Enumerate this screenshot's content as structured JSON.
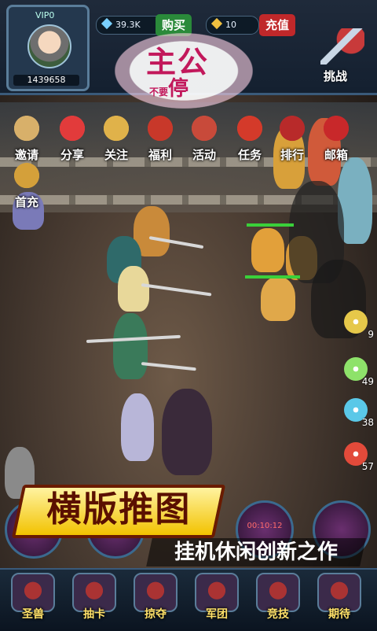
{
  "player": {
    "level_label": "VIP0",
    "power": "1439658"
  },
  "resources": {
    "gems": "39.3K",
    "stamina": "10"
  },
  "top_buttons": {
    "buy_label": "购买",
    "recharge_label": "充值",
    "challenge_label": "挑战"
  },
  "logo": {
    "line1": "主公",
    "line2_small": "不要",
    "line2_big": "停"
  },
  "menu": [
    {
      "label": "邀请",
      "icon": "horn-icon",
      "color": "#d8b06a"
    },
    {
      "label": "分享",
      "icon": "heart-icon",
      "color": "#e23b3b"
    },
    {
      "label": "关注",
      "icon": "scroll-icon",
      "color": "#e0b24a"
    },
    {
      "label": "福利",
      "icon": "giftbox-icon",
      "color": "#c8382a"
    },
    {
      "label": "活动",
      "icon": "drum-icon",
      "color": "#c84a3a"
    },
    {
      "label": "任务",
      "icon": "flag-icon",
      "color": "#d43a2a"
    },
    {
      "label": "排行",
      "icon": "ranking-icon",
      "color": "#b82a2a"
    },
    {
      "label": "邮箱",
      "icon": "mailbox-icon",
      "color": "#c8282a"
    },
    {
      "label": "首充",
      "icon": "treasure-chest-icon",
      "color": "#d4a03a"
    }
  ],
  "drops": [
    {
      "count": "9",
      "color": "#e6c84a"
    },
    {
      "count": "49",
      "color": "#8ee26a"
    },
    {
      "count": "38",
      "color": "#5ac8e8"
    },
    {
      "count": "57",
      "color": "#e24a3a"
    }
  ],
  "skill_buttons": [
    {
      "text": ""
    },
    {
      "text": ""
    },
    {
      "text": "00:10:12"
    },
    {
      "text": ""
    }
  ],
  "banner": {
    "main": "横版推图",
    "sub": "挂机休闲创新之作"
  },
  "bottom_nav": [
    {
      "label": "圣兽",
      "icon": "beast-icon"
    },
    {
      "label": "抽卡",
      "icon": "card-draw-icon"
    },
    {
      "label": "掠夺",
      "icon": "plunder-icon"
    },
    {
      "label": "军团",
      "icon": "legion-icon"
    },
    {
      "label": "竞技",
      "icon": "arena-icon"
    },
    {
      "label": "期待",
      "icon": "coming-soon-icon"
    }
  ]
}
